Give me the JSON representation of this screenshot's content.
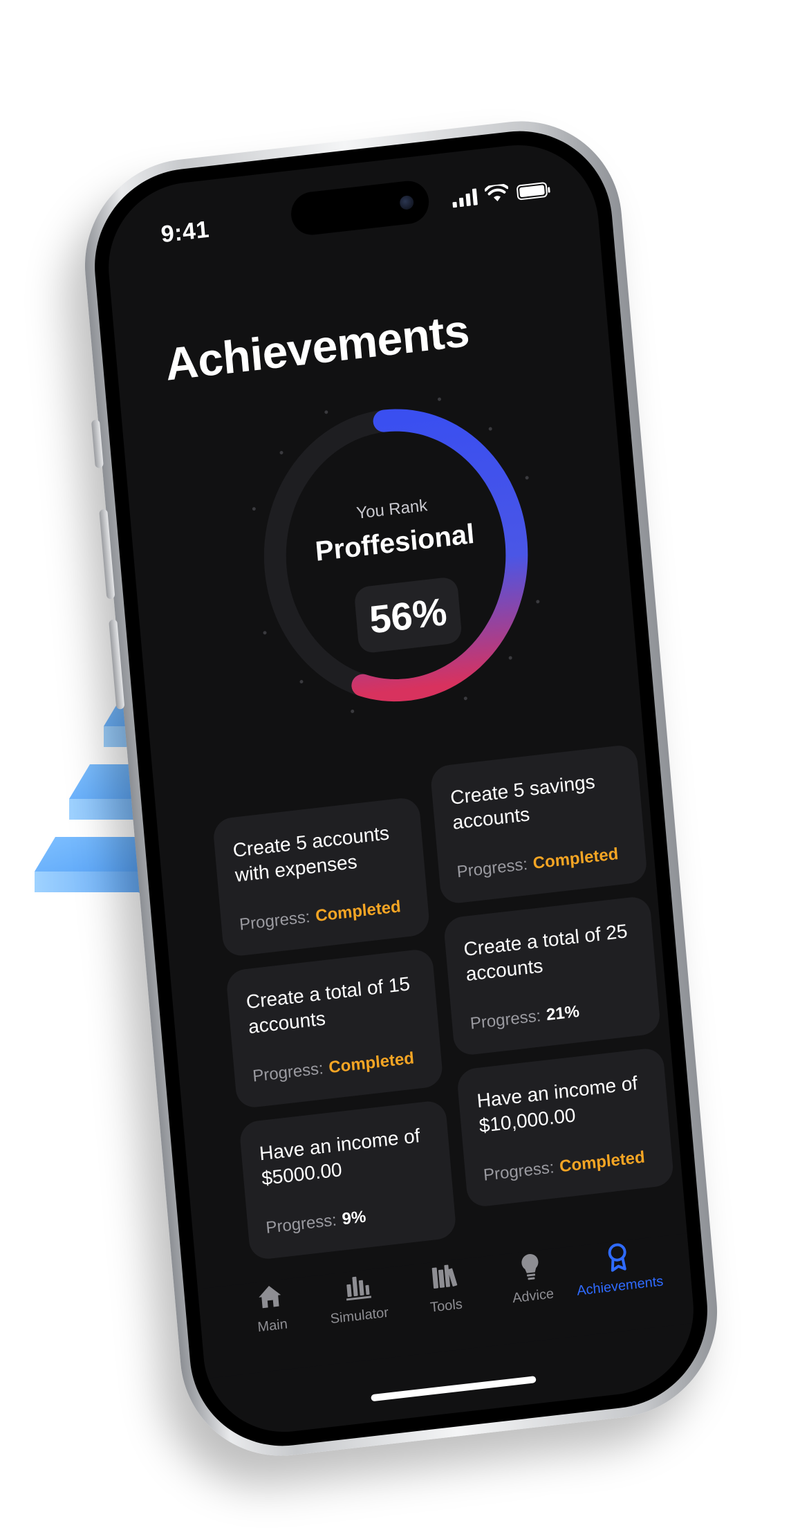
{
  "status_bar": {
    "time": "9:41"
  },
  "page": {
    "title": "Achievements"
  },
  "rank": {
    "label": "You Rank",
    "name": "Proffesional",
    "percent_text": "56%",
    "progress": 0.56
  },
  "cards": [
    {
      "title": "Create 5 accounts with expenses",
      "progress_label": "Progress:",
      "progress_value": "Completed",
      "status": "done"
    },
    {
      "title": "Create 5 savings accounts",
      "progress_label": "Progress:",
      "progress_value": "Completed",
      "status": "done"
    },
    {
      "title": "Create a total of 15 accounts",
      "progress_label": "Progress:",
      "progress_value": "Completed",
      "status": "done"
    },
    {
      "title": "Create a total of 25 accounts",
      "progress_label": "Progress:",
      "progress_value": "21%",
      "status": "pct"
    },
    {
      "title": "Have an income of $5000.00",
      "progress_label": "Progress:",
      "progress_value": "9%",
      "status": "pct"
    },
    {
      "title": "Have an income of $10,000.00",
      "progress_label": "Progress:",
      "progress_value": "Completed",
      "status": "done"
    }
  ],
  "tabs": [
    {
      "label": "Main",
      "icon": "home-icon",
      "active": false
    },
    {
      "label": "Simulator",
      "icon": "chart-bars-icon",
      "active": false
    },
    {
      "label": "Tools",
      "icon": "books-icon",
      "active": false
    },
    {
      "label": "Advice",
      "icon": "lightbulb-icon",
      "active": false
    },
    {
      "label": "Achievements",
      "icon": "award-ribbon-icon",
      "active": true
    }
  ],
  "colors": {
    "accent": "#2f6bff",
    "completed": "#f5a524",
    "ring_start": "#3a4ff0",
    "ring_end": "#d8325e",
    "screen_bg": "#111112",
    "card_bg": "#1f1f22"
  }
}
